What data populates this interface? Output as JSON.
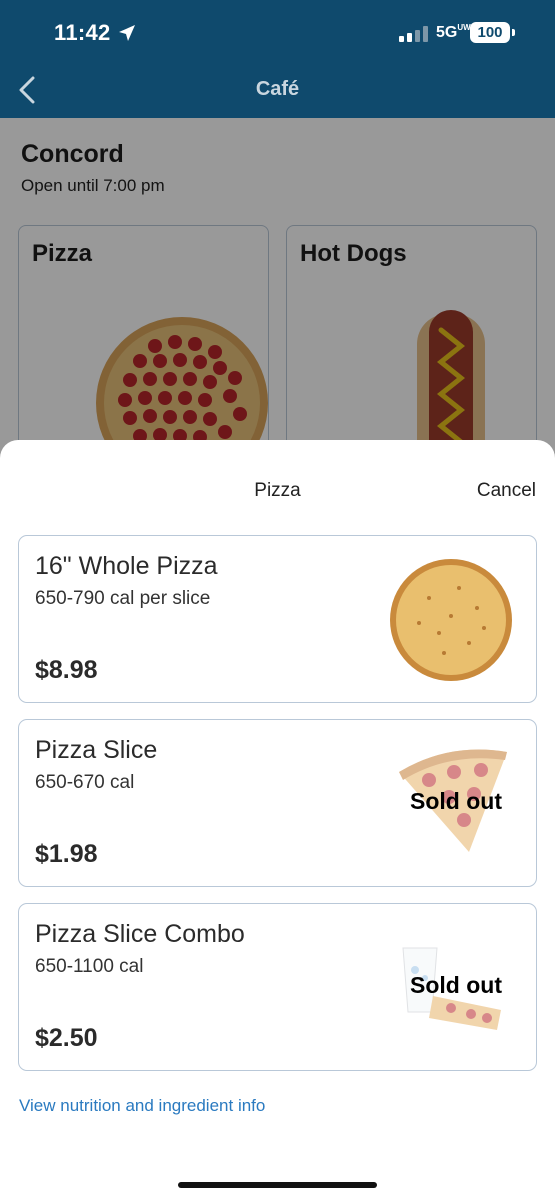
{
  "status_bar": {
    "time": "11:42",
    "network": "5G",
    "network_sup": "UW",
    "battery": "100"
  },
  "nav": {
    "title": "Café",
    "back_icon": "chevron-left-icon"
  },
  "store": {
    "name": "Concord",
    "hours": "Open until 7:00 pm"
  },
  "categories": [
    {
      "label": "Pizza"
    },
    {
      "label": "Hot Dogs"
    }
  ],
  "sheet": {
    "title": "Pizza",
    "cancel_label": "Cancel",
    "items": [
      {
        "name": "16\" Whole Pizza",
        "calories": "650-790 cal per slice",
        "price": "$8.98",
        "status": ""
      },
      {
        "name": "Pizza Slice",
        "calories": "650-670 cal",
        "price": "$1.98",
        "status": "Sold out"
      },
      {
        "name": "Pizza Slice Combo",
        "calories": "650-1100 cal",
        "price": "$2.50",
        "status": "Sold out"
      }
    ],
    "nutrition_link": "View nutrition and ingredient info"
  },
  "colors": {
    "header_bg": "#0f4a6d",
    "link": "#2a7ac0",
    "card_border": "#b9c8d8"
  }
}
